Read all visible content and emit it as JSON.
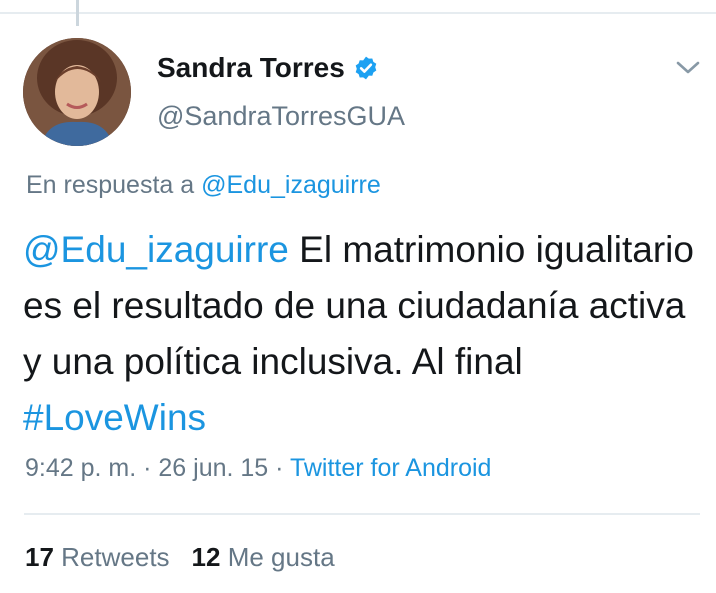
{
  "author": {
    "display_name": "Sandra Torres",
    "handle": "@SandraTorresGUA",
    "verified_icon": "verified-badge-icon",
    "avatar": "profile-photo"
  },
  "menu_icon": "chevron-down-icon",
  "reply_to": {
    "prefix": "En respuesta a",
    "mention": "@Edu_izaguirre"
  },
  "tweet": {
    "mention": "@Edu_izaguirre",
    "text": " El matrimonio igualitario es el resultado de una ciudadanía activa y una política inclusiva. Al final ",
    "hashtag": "#LoveWins"
  },
  "meta": {
    "time": "9:42 p. m.",
    "sep1": " · ",
    "date": "26 jun. 15",
    "sep2": " · ",
    "source": "Twitter for Android"
  },
  "stats": {
    "retweets_count": "17",
    "retweets_label": "Retweets",
    "likes_count": "12",
    "likes_label": "Me gusta"
  },
  "colors": {
    "link": "#1b95e0",
    "secondary_text": "#657786",
    "primary_text": "#14171a",
    "divider": "#e6ecf0"
  }
}
